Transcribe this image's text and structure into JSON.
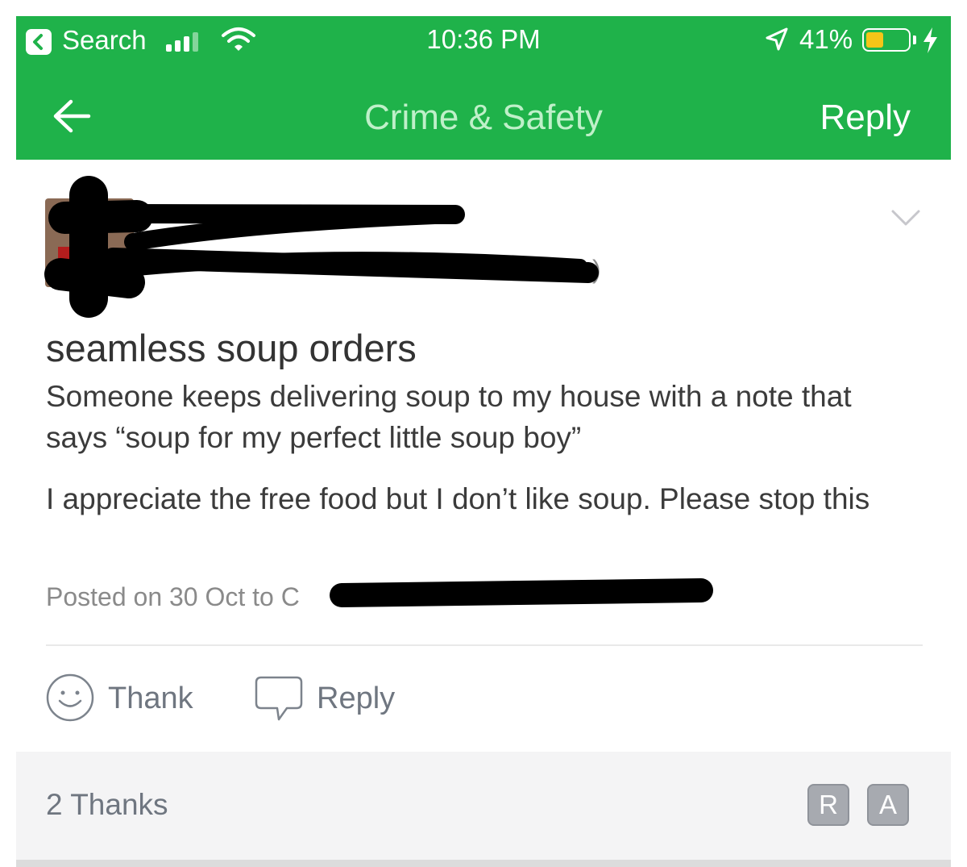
{
  "status_bar": {
    "back_app_label": "Search",
    "time": "10:36 PM",
    "battery_percent": "41%",
    "battery_level": 0.41,
    "battery_color": "#f5c518"
  },
  "nav": {
    "title": "Crime & Safety",
    "reply_label": "Reply",
    "back_icon": "arrow-left-icon"
  },
  "post": {
    "title": "seamless soup orders",
    "paragraphs": [
      "Someone keeps delivering soup to my house with a note that says “soup for my perfect little soup boy”",
      "I appreciate the free food but I don’t like soup. Please stop this"
    ],
    "posted_prefix": "Posted on 30 Oct to C",
    "neighborhood_suffix": ")"
  },
  "actions": {
    "thank_label": "Thank",
    "reply_label": "Reply",
    "thank_icon": "smiley-icon",
    "reply_icon": "speech-bubble-icon"
  },
  "thanks": {
    "count_label": "2 Thanks",
    "avatars": [
      "R",
      "A"
    ]
  },
  "colors": {
    "brand_green": "#1fb24a",
    "nav_title": "#bff0c9"
  }
}
